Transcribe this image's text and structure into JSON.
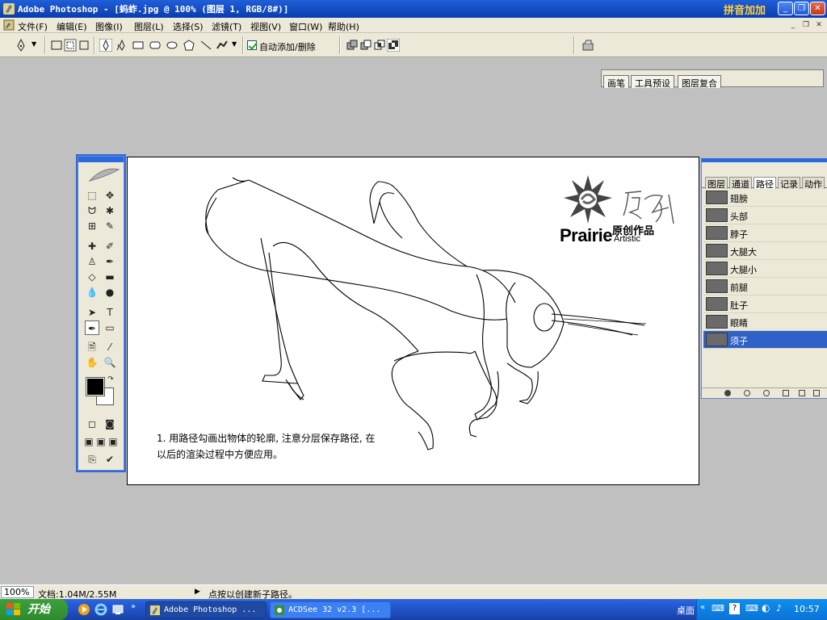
{
  "window": {
    "title": "Adobe Photoshop - [蚂蚱.jpg @ 100% (图层 1, RGB/8#)]",
    "ime_label": "拼音加加"
  },
  "menu": [
    "文件(F)",
    "编辑(E)",
    "图像(I)",
    "图层(L)",
    "选择(S)",
    "滤镜(T)",
    "视图(V)",
    "窗口(W)",
    "帮助(H)"
  ],
  "options": {
    "auto_add_delete": "自动添加/删除",
    "auto_add_delete_checked": true
  },
  "palette_well": {
    "tabs": [
      "画笔",
      "工具预设",
      "图层复合"
    ]
  },
  "canvas": {
    "logo_brand": "Prairie",
    "logo_sub": "Artistic",
    "logo_cn": "原创作品",
    "caption_line1": "1. 用路径勾画出物体的轮廓, 注意分层保存路径, 在",
    "caption_line2": "以后的渲染过程中方便应用。"
  },
  "paths_panel": {
    "tabs": [
      "图层",
      "通道",
      "路径",
      "记录",
      "动作"
    ],
    "active_tab": "路径",
    "items": [
      {
        "name": "翅膀"
      },
      {
        "name": "头部"
      },
      {
        "name": "脖子"
      },
      {
        "name": "大腿大"
      },
      {
        "name": "大腿小"
      },
      {
        "name": "前腿"
      },
      {
        "name": "肚子"
      },
      {
        "name": "眼睛"
      },
      {
        "name": "须子"
      }
    ],
    "selected": "须子"
  },
  "status": {
    "zoom": "100%",
    "doc_size": "文档:1.04M/2.55M",
    "hint": "点按以创建新子路径。"
  },
  "taskbar": {
    "start": "开始",
    "tasks": [
      "Adobe Photoshop ...",
      "ACDSee 32 v2.3 [..."
    ],
    "desktop_label": "桌面",
    "clock": "10:57"
  }
}
